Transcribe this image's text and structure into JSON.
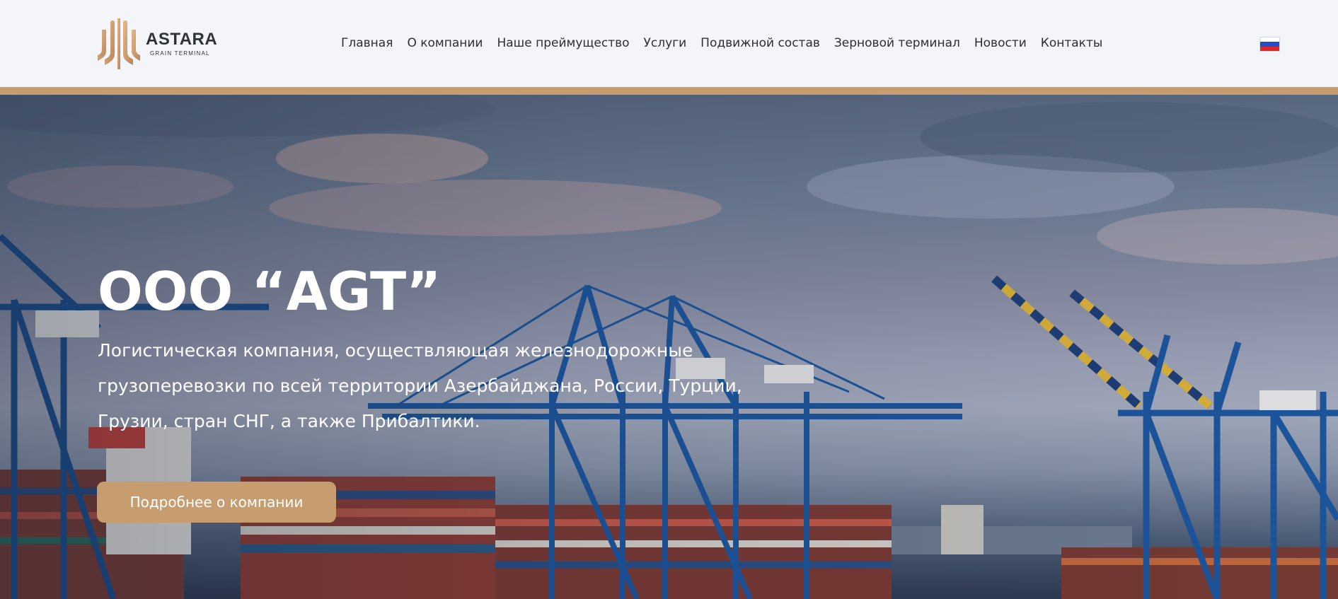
{
  "brand": {
    "name": "ASTARA",
    "subtitle": "GRAIN TERMINAL",
    "accent_color": "#c79d70"
  },
  "nav": {
    "items": [
      {
        "label": "Главная"
      },
      {
        "label": "О компании"
      },
      {
        "label": "Наше преймущество"
      },
      {
        "label": "Услуги"
      },
      {
        "label": "Подвижной состав"
      },
      {
        "label": "Зерновой терминал"
      },
      {
        "label": "Новости"
      },
      {
        "label": "Контакты"
      }
    ]
  },
  "language": {
    "icon": "russia-flag-icon",
    "colors": [
      "#ffffff",
      "#1f4fc9",
      "#e0262b"
    ]
  },
  "hero": {
    "title": "ООО “AGT”",
    "description": "Логистическая компания, осуществляющая железнодорожные грузоперевозки по всей территории Азербайджана, России, Турции, Грузии, стран СНГ, а также Прибалтики.",
    "button_label": "Подробнее о компании",
    "background": "port-cranes-containers-photo"
  }
}
